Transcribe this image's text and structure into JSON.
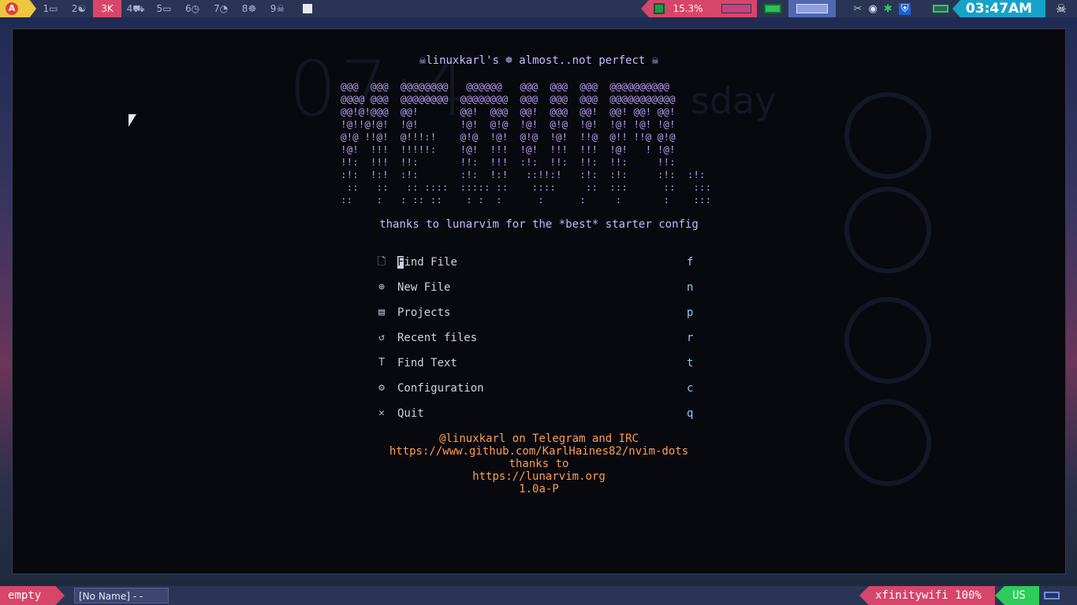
{
  "topbar": {
    "launcher_icon": "app-launcher-icon",
    "launcher_letter": "A",
    "workspaces": [
      "1",
      "2",
      "3",
      "4",
      "5",
      "6",
      "7",
      "8",
      "9"
    ],
    "workspace_glyphs": [
      "▭",
      "☯",
      "K",
      "⛟",
      "▭",
      "◷",
      "◔",
      "☸",
      "☠"
    ],
    "active_workspace": "3",
    "cpu_percent": "15.3%",
    "clock": "03:47AM",
    "tray_icons": [
      "scissors-icon",
      "wifi-icon",
      "bluetooth-icon",
      "shield-icon"
    ],
    "colors": {
      "accent_pink": "#d8456a",
      "accent_cyan": "#17a3c8",
      "accent_green": "#2ecc5a",
      "bar_bg": "#2a3556"
    }
  },
  "editor": {
    "greeting": "☠linuxkarl's ☸ almost..not perfect ☠",
    "ascii_art": [
      "@@@  @@@  @@@@@@@@   @@@@@@   @@@  @@@  @@@  @@@@@@@@@@",
      "@@@@ @@@  @@@@@@@@  @@@@@@@@  @@@  @@@  @@@  @@@@@@@@@@@",
      "@@!@!@@@  @@!       @@!  @@@  @@!  @@@  @@!  @@! @@! @@!",
      "!@!!@!@!  !@!       !@!  @!@  !@!  @!@  !@!  !@! !@! !@!",
      "@!@ !!@!  @!!!:!    @!@  !@!  @!@  !@!  !!@  @!! !!@ @!@",
      "!@!  !!!  !!!!!:    !@!  !!!  !@!  !!!  !!!  !@!   ! !@!",
      "!!:  !!!  !!:       !!:  !!!  :!:  !!:  !!:  !!:     !!:",
      ":!:  !:!  :!:       :!:  !:!   ::!!:!   :!:  :!:     :!:  :!:",
      " ::   ::   :: ::::  ::::: ::    ::::     ::  :::      ::   :::",
      "::    :   : :: ::    : :  :      :      :     :       :    :::"
    ],
    "tagline": "thanks to lunarvim for the *best* starter config",
    "menu": [
      {
        "icon": "🗋",
        "label": "Find File",
        "key": "f"
      },
      {
        "icon": "⊕",
        "label": "New File",
        "key": "n"
      },
      {
        "icon": "▤",
        "label": "Projects",
        "key": "p"
      },
      {
        "icon": "↺",
        "label": "Recent files",
        "key": "r"
      },
      {
        "icon": "T",
        "label": "Find Text",
        "key": "t"
      },
      {
        "icon": "⚙",
        "label": "Configuration",
        "key": "c"
      },
      {
        "icon": "✕",
        "label": "Quit",
        "key": "q"
      }
    ],
    "footer": [
      "@linuxkarl on Telegram and IRC",
      "https://www.github.com/KarlHaines82/nvim-dots",
      "thanks to",
      "https://lunarvim.org",
      "1.0a-P"
    ]
  },
  "bottombar": {
    "layout": "empty",
    "window_title": "[No Name] - - NVIM",
    "wifi": "xfinitywifi 100%",
    "keyboard": "US"
  }
}
